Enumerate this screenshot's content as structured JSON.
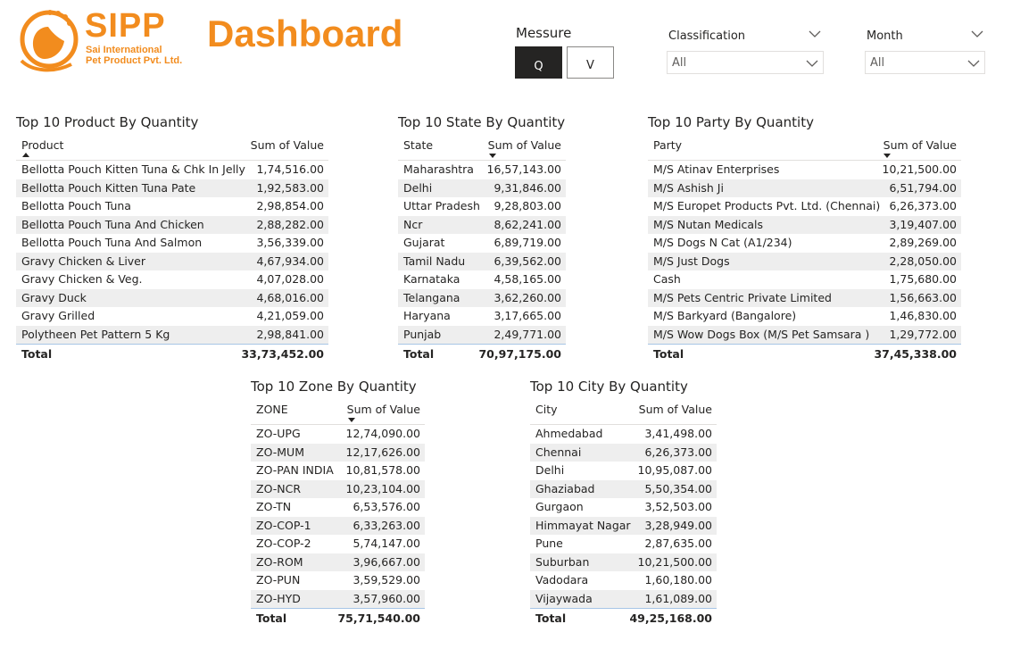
{
  "header": {
    "brand": "SIPP",
    "brand_sub_line1": "Sai International",
    "brand_sub_line2": "Pet Product Pvt. Ltd.",
    "dashboard_title": "Dashboard",
    "brand_color": "#f28c1e"
  },
  "measure": {
    "label": "Messure",
    "options": [
      "Q",
      "V"
    ],
    "selected": "Q"
  },
  "filters": {
    "classification": {
      "title": "Classification",
      "value": "All"
    },
    "month": {
      "title": "Month",
      "value": "All"
    }
  },
  "tables": {
    "product": {
      "title": "Top 10 Product By Quantity",
      "col1": "Product",
      "col2": "Sum of Value",
      "rows": [
        [
          "Bellotta Pouch Kitten Tuna & Chk In Jelly",
          "1,74,516.00"
        ],
        [
          "Bellotta Pouch Kitten Tuna Pate",
          "1,92,583.00"
        ],
        [
          "Bellotta Pouch Tuna",
          "2,98,854.00"
        ],
        [
          "Bellotta Pouch Tuna And Chicken",
          "2,88,282.00"
        ],
        [
          "Bellotta Pouch Tuna And Salmon",
          "3,56,339.00"
        ],
        [
          "Gravy Chicken & Liver",
          "4,67,934.00"
        ],
        [
          "Gravy Chicken & Veg.",
          "4,07,028.00"
        ],
        [
          "Gravy Duck",
          "4,68,016.00"
        ],
        [
          "Gravy Grilled",
          "4,21,059.00"
        ],
        [
          "Polytheen Pet Pattern 5 Kg",
          "2,98,841.00"
        ]
      ],
      "total_label": "Total",
      "total_value": "33,73,452.00"
    },
    "state": {
      "title": "Top 10 State By Quantity",
      "col1": "State",
      "col2": "Sum of Value",
      "rows": [
        [
          "Maharashtra",
          "16,57,143.00"
        ],
        [
          "Delhi",
          "9,31,846.00"
        ],
        [
          "Uttar Pradesh",
          "9,28,803.00"
        ],
        [
          "Ncr",
          "8,62,241.00"
        ],
        [
          "Gujarat",
          "6,89,719.00"
        ],
        [
          "Tamil Nadu",
          "6,39,562.00"
        ],
        [
          "Karnataka",
          "4,58,165.00"
        ],
        [
          "Telangana",
          "3,62,260.00"
        ],
        [
          "Haryana",
          "3,17,665.00"
        ],
        [
          "Punjab",
          "2,49,771.00"
        ]
      ],
      "total_label": "Total",
      "total_value": "70,97,175.00"
    },
    "party": {
      "title": "Top 10 Party By Quantity",
      "col1": "Party",
      "col2": "Sum of Value",
      "rows": [
        [
          "M/S Atinav Enterprises",
          "10,21,500.00"
        ],
        [
          "M/S Ashish Ji",
          "6,51,794.00"
        ],
        [
          "M/S Europet Products Pvt. Ltd. (Chennai)",
          "6,26,373.00"
        ],
        [
          "M/S Nutan Medicals",
          "3,19,407.00"
        ],
        [
          "M/S Dogs N Cat (A1/234)",
          "2,89,269.00"
        ],
        [
          "M/S Just Dogs",
          "2,28,050.00"
        ],
        [
          "Cash",
          "1,75,680.00"
        ],
        [
          "M/S Pets Centric Private Limited",
          "1,56,663.00"
        ],
        [
          "M/S Barkyard (Bangalore)",
          "1,46,830.00"
        ],
        [
          "M/S Wow Dogs Box (M/S Pet Samsara )",
          "1,29,772.00"
        ]
      ],
      "total_label": "Total",
      "total_value": "37,45,338.00"
    },
    "zone": {
      "title": "Top 10 Zone By Quantity",
      "col1": "ZONE",
      "col2": "Sum of Value",
      "rows": [
        [
          "ZO-UPG",
          "12,74,090.00"
        ],
        [
          "ZO-MUM",
          "12,17,626.00"
        ],
        [
          "ZO-PAN INDIA",
          "10,81,578.00"
        ],
        [
          "ZO-NCR",
          "10,23,104.00"
        ],
        [
          "ZO-TN",
          "6,53,576.00"
        ],
        [
          "ZO-COP-1",
          "6,33,263.00"
        ],
        [
          "ZO-COP-2",
          "5,74,147.00"
        ],
        [
          "ZO-ROM",
          "3,96,667.00"
        ],
        [
          "ZO-PUN",
          "3,59,529.00"
        ],
        [
          "ZO-HYD",
          "3,57,960.00"
        ]
      ],
      "total_label": "Total",
      "total_value": "75,71,540.00"
    },
    "city": {
      "title": "Top 10 City By Quantity",
      "col1": "City",
      "col2": "Sum of Value",
      "rows": [
        [
          "Ahmedabad",
          "3,41,498.00"
        ],
        [
          "Chennai",
          "6,26,373.00"
        ],
        [
          "Delhi",
          "10,95,087.00"
        ],
        [
          "Ghaziabad",
          "5,50,354.00"
        ],
        [
          "Gurgaon",
          "3,52,503.00"
        ],
        [
          "Himmayat Nagar",
          "3,28,949.00"
        ],
        [
          "Pune",
          "2,87,635.00"
        ],
        [
          "Suburban",
          "10,21,500.00"
        ],
        [
          "Vadodara",
          "1,60,180.00"
        ],
        [
          "Vijaywada",
          "1,61,089.00"
        ]
      ],
      "total_label": "Total",
      "total_value": "49,25,168.00"
    }
  }
}
